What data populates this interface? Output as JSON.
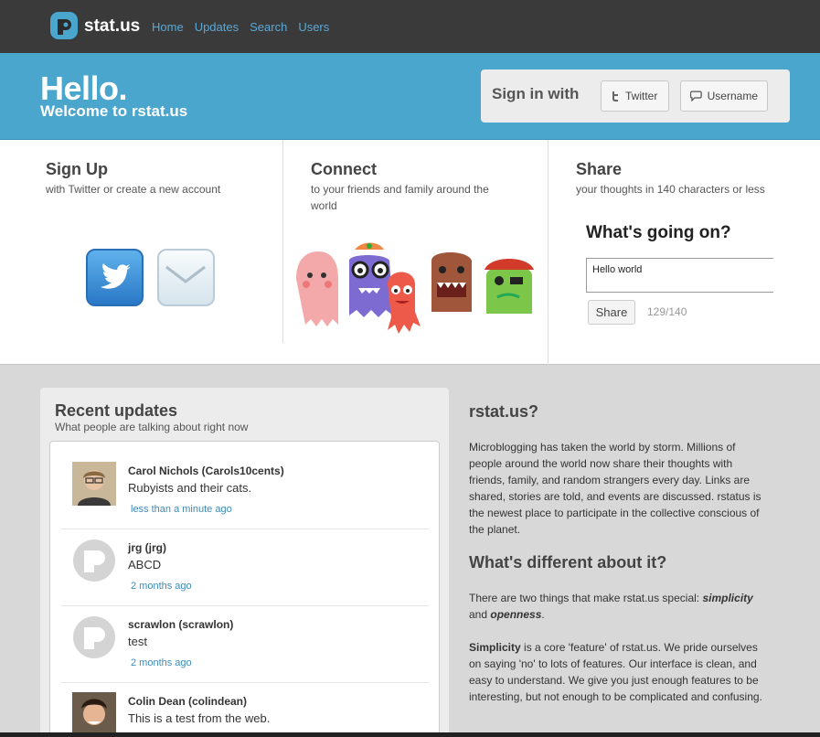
{
  "topbar": {
    "brand": "stat.us",
    "nav": [
      "Home",
      "Updates",
      "Search",
      "Users"
    ]
  },
  "hero": {
    "hello": "Hello.",
    "welcome": "Welcome to rstat.us",
    "signin_label": "Sign in with",
    "twitter_button": "Twitter",
    "username_button": "Username"
  },
  "features": {
    "signup": {
      "title": "Sign Up",
      "desc": "with Twitter or create a new account"
    },
    "connect": {
      "title": "Connect",
      "desc": "to your friends and family around the world"
    },
    "share": {
      "title": "Share",
      "desc": "your thoughts in 140 characters or less"
    }
  },
  "composer": {
    "title": "What's going on?",
    "value": "Hello world",
    "share_button": "Share",
    "counter": "129/140"
  },
  "recent": {
    "title": "Recent updates",
    "subtitle": "What people are talking about right now",
    "updates": [
      {
        "name": "Carol Nichols (Carols10cents)",
        "text": "Rubyists and their cats.",
        "time": "less than a minute ago",
        "avatar": "photo"
      },
      {
        "name": "jrg (jrg)",
        "text": "ABCD",
        "time": "2 months ago",
        "avatar": "default"
      },
      {
        "name": "scrawlon (scrawlon)",
        "text": "test",
        "time": "2 months ago",
        "avatar": "default"
      },
      {
        "name": "Colin Dean (colindean)",
        "text": "This is a test from the web.",
        "time": "",
        "avatar": "photo"
      }
    ]
  },
  "about": {
    "title": "rstat.us?",
    "intro": "Microblogging has taken the world by storm. Millions of people around the world now share their thoughts with friends, family, and random strangers every day. Links are shared, stories are told, and events are discussed. rstatus is the newest place to participate in the collective conscious of the planet.",
    "diff_title": "What's different about it?",
    "diff_text_1": "There are two things that make rstat.us special:",
    "diff_simplicity": "simplicity",
    "diff_and": "and",
    "diff_openness": "openness",
    "diff_period": ".",
    "simplicity_label": "Simplicity",
    "simplicity_text": " is a core 'feature' of rstat.us. We pride ourselves on saying 'no' to lots of features. Our interface is clean, and easy to understand. We give you just enough features to be interesting, but not enough to be complicated and confusing."
  },
  "colors": {
    "topbar": "#3a3a3a",
    "hero": "#4aa6cd",
    "link": "#5aa8d6",
    "body_bg": "#d8d8d8"
  }
}
